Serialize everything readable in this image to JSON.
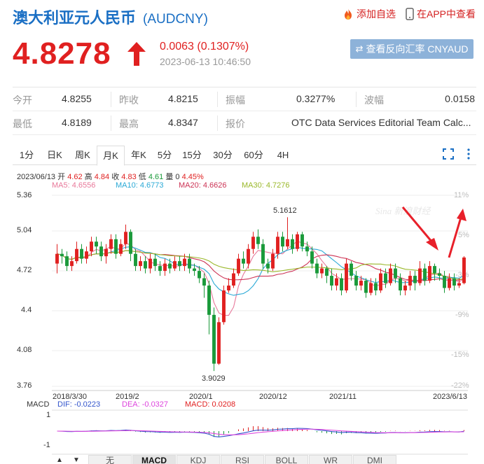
{
  "header": {
    "title": "澳大利亚元人民币",
    "code": "(AUDCNY)",
    "add_watch": "添加自选",
    "app_view": "在APP中查看"
  },
  "quote": {
    "price": "4.8278",
    "change": "0.0063 (0.1307%)",
    "time": "2023-06-13 10:46:50",
    "reverse_button": "查看反向汇率 CNYAUD"
  },
  "stats": {
    "row1": [
      {
        "label": "今开",
        "value": "4.8255"
      },
      {
        "label": "昨收",
        "value": "4.8215"
      },
      {
        "label": "振幅",
        "value": "0.3277%"
      },
      {
        "label": "波幅",
        "value": "0.0158"
      }
    ],
    "row2": [
      {
        "label": "最低",
        "value": "4.8189"
      },
      {
        "label": "最高",
        "value": "4.8347"
      },
      {
        "label": "报价",
        "value": "OTC Data Services Editorial Team Calc..."
      }
    ]
  },
  "tabs": [
    "1分",
    "日K",
    "周K",
    "月K",
    "年K",
    "5分",
    "15分",
    "30分",
    "60分",
    "4H"
  ],
  "active_tab": "月K",
  "ohlc": {
    "date": "2023/06/13",
    "open_label": "开",
    "open": "4.62",
    "high_label": "高",
    "high": "4.84",
    "close_label": "收",
    "close": "4.83",
    "low_label": "低",
    "low": "4.61",
    "vol_label": "量",
    "vol": "0",
    "pct": "4.45%"
  },
  "ma_labels": {
    "ma5": "MA5: 4.6556",
    "ma10": "MA10: 4.6773",
    "ma20": "MA20: 4.6626",
    "ma30": "MA30: 4.7276"
  },
  "colors": {
    "up": "#e02020",
    "down": "#1a9a3a",
    "ma5": "#e8789a",
    "ma10": "#2aa9d6",
    "ma20": "#cc3355",
    "ma30": "#9ab82a",
    "dif": "#3355cc",
    "dea": "#dd44dd"
  },
  "chart_data": {
    "type": "candlestick",
    "y_left_ticks": [
      "5.36",
      "5.04",
      "4.72",
      "4.4",
      "4.08",
      "3.76"
    ],
    "y_right_ticks": [
      "11%",
      "5%",
      "-3%",
      "-9%",
      "-15%",
      "-22%"
    ],
    "x_labels": [
      "2018/3/30",
      "2019/2",
      "2020/1",
      "2020/12",
      "2021/11",
      "2023/6/13"
    ],
    "ylim": [
      3.74,
      5.38
    ],
    "annotations": {
      "high": "5.1612",
      "low": "3.9029"
    },
    "candles": [
      [
        4.78,
        4.86,
        4.7,
        4.94
      ],
      [
        4.86,
        4.84,
        4.78,
        4.9
      ],
      [
        4.84,
        4.76,
        4.72,
        4.88
      ],
      [
        4.76,
        4.8,
        4.72,
        4.84
      ],
      [
        4.8,
        4.9,
        4.78,
        4.96
      ],
      [
        4.9,
        4.82,
        4.78,
        4.94
      ],
      [
        4.82,
        4.88,
        4.78,
        4.92
      ],
      [
        4.88,
        4.96,
        4.84,
        5.0
      ],
      [
        4.96,
        4.92,
        4.86,
        5.0
      ],
      [
        4.92,
        4.84,
        4.8,
        4.96
      ],
      [
        4.84,
        4.9,
        4.78,
        4.94
      ],
      [
        4.9,
        4.98,
        4.86,
        5.02
      ],
      [
        4.98,
        4.86,
        4.82,
        5.02
      ],
      [
        4.86,
        4.94,
        4.84,
        4.98
      ],
      [
        4.94,
        5.04,
        4.9,
        5.1
      ],
      [
        5.04,
        4.86,
        4.8,
        5.06
      ],
      [
        4.86,
        4.76,
        4.72,
        4.9
      ],
      [
        4.76,
        4.8,
        4.72,
        4.84
      ],
      [
        4.8,
        4.74,
        4.7,
        4.84
      ],
      [
        4.74,
        4.82,
        4.7,
        4.86
      ],
      [
        4.82,
        4.76,
        4.72,
        4.86
      ],
      [
        4.76,
        4.72,
        4.68,
        4.8
      ],
      [
        4.72,
        4.78,
        4.68,
        4.82
      ],
      [
        4.78,
        4.74,
        4.7,
        4.82
      ],
      [
        4.74,
        4.8,
        4.72,
        4.84
      ],
      [
        4.8,
        4.76,
        4.72,
        4.84
      ],
      [
        4.76,
        4.82,
        4.72,
        4.86
      ],
      [
        4.82,
        4.74,
        4.7,
        4.86
      ],
      [
        4.74,
        4.72,
        4.68,
        4.78
      ],
      [
        4.72,
        4.66,
        4.62,
        4.76
      ],
      [
        4.66,
        4.6,
        4.5,
        4.7
      ],
      [
        4.6,
        4.36,
        4.2,
        4.64
      ],
      [
        4.36,
        3.96,
        3.9,
        4.42
      ],
      [
        3.96,
        4.3,
        3.95,
        4.34
      ],
      [
        4.3,
        4.56,
        4.28,
        4.6
      ],
      [
        4.56,
        4.6,
        4.54,
        4.66
      ],
      [
        4.6,
        4.7,
        4.58,
        4.74
      ],
      [
        4.7,
        4.82,
        4.68,
        4.86
      ],
      [
        4.82,
        4.78,
        4.74,
        4.88
      ],
      [
        4.78,
        4.9,
        4.74,
        4.94
      ],
      [
        4.9,
        5.0,
        4.86,
        5.04
      ],
      [
        5.0,
        4.94,
        4.9,
        5.06
      ],
      [
        4.94,
        4.78,
        4.74,
        4.98
      ],
      [
        4.78,
        4.74,
        4.7,
        4.82
      ],
      [
        4.74,
        4.86,
        4.72,
        4.9
      ],
      [
        4.86,
        5.0,
        4.82,
        5.04
      ],
      [
        5.0,
        4.92,
        4.88,
        5.04
      ],
      [
        4.92,
        4.98,
        4.9,
        5.16
      ],
      [
        4.98,
        4.9,
        4.86,
        5.02
      ],
      [
        4.9,
        5.02,
        4.88,
        5.04
      ],
      [
        5.02,
        4.92,
        4.88,
        5.04
      ],
      [
        4.92,
        4.88,
        4.84,
        4.96
      ],
      [
        4.88,
        4.78,
        4.74,
        4.92
      ],
      [
        4.78,
        4.7,
        4.66,
        4.82
      ],
      [
        4.7,
        4.74,
        4.66,
        4.78
      ],
      [
        4.74,
        4.68,
        4.62,
        4.76
      ],
      [
        4.68,
        4.6,
        4.56,
        4.74
      ],
      [
        4.6,
        4.66,
        4.56,
        4.7
      ],
      [
        4.66,
        4.56,
        4.52,
        4.7
      ],
      [
        4.56,
        4.78,
        4.54,
        4.82
      ],
      [
        4.78,
        4.68,
        4.64,
        4.8
      ],
      [
        4.68,
        4.6,
        4.56,
        4.72
      ],
      [
        4.6,
        4.64,
        4.56,
        4.68
      ],
      [
        4.64,
        4.54,
        4.5,
        4.66
      ],
      [
        4.54,
        4.62,
        4.52,
        4.66
      ],
      [
        4.62,
        4.56,
        4.52,
        4.66
      ],
      [
        4.56,
        4.7,
        4.54,
        4.74
      ],
      [
        4.7,
        4.62,
        4.58,
        4.74
      ],
      [
        4.62,
        4.74,
        4.6,
        4.78
      ],
      [
        4.74,
        4.66,
        4.62,
        4.78
      ],
      [
        4.66,
        4.56,
        4.52,
        4.7
      ],
      [
        4.56,
        4.6,
        4.52,
        4.64
      ],
      [
        4.6,
        4.68,
        4.56,
        4.72
      ],
      [
        4.68,
        4.62,
        4.56,
        4.72
      ],
      [
        4.62,
        4.74,
        4.6,
        4.8
      ],
      [
        4.74,
        4.64,
        4.6,
        4.78
      ],
      [
        4.64,
        4.76,
        4.62,
        4.8
      ],
      [
        4.76,
        4.7,
        4.64,
        4.78
      ],
      [
        4.7,
        4.68,
        4.64,
        4.74
      ],
      [
        4.68,
        4.58,
        4.54,
        4.72
      ],
      [
        4.58,
        4.66,
        4.56,
        4.7
      ],
      [
        4.66,
        4.6,
        4.56,
        4.7
      ],
      [
        4.6,
        4.62,
        4.58,
        4.66
      ],
      [
        4.62,
        4.83,
        4.61,
        4.84
      ]
    ],
    "macd_labels": {
      "title": "MACD",
      "dif": "DIF: -0.0223",
      "dea": "DEA: -0.0327",
      "macd": "MACD: 0.0208"
    },
    "macd_ticks": [
      "1",
      "-1"
    ]
  },
  "bottom_tabs": [
    "无",
    "MACD",
    "KDJ",
    "RSI",
    "BOLL",
    "WR",
    "DMI"
  ],
  "bottom_active": "MACD"
}
